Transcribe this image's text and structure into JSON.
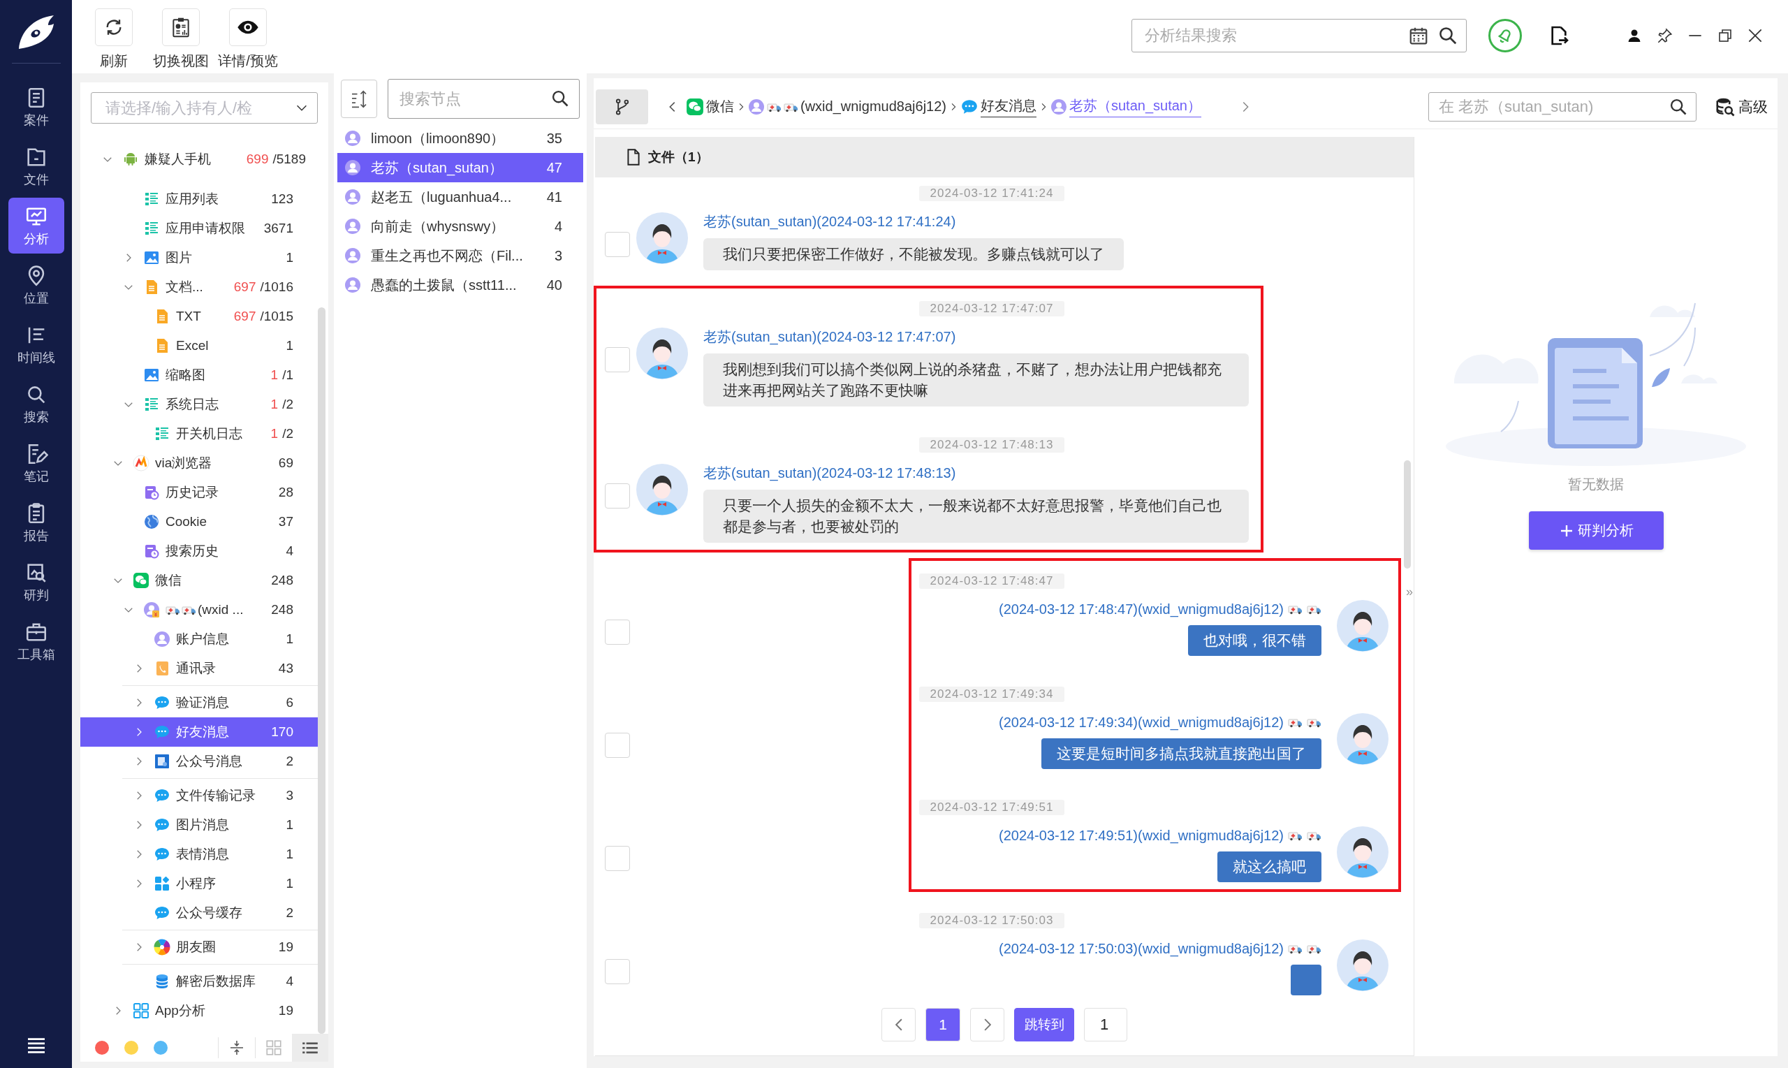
{
  "nav": {
    "items": [
      {
        "kind": "case",
        "label": "案件",
        "selected": false
      },
      {
        "kind": "file",
        "label": "文件",
        "selected": false
      },
      {
        "kind": "analysis",
        "label": "分析",
        "selected": true
      },
      {
        "kind": "location",
        "label": "位置",
        "selected": false
      },
      {
        "kind": "timeline",
        "label": "时间线",
        "selected": false
      },
      {
        "kind": "search",
        "label": "搜索",
        "selected": false
      },
      {
        "kind": "notes",
        "label": "笔记",
        "selected": false
      },
      {
        "kind": "report",
        "label": "报告",
        "selected": false
      },
      {
        "kind": "judge",
        "label": "研判",
        "selected": false
      },
      {
        "kind": "toolbox",
        "label": "工具箱",
        "selected": false
      }
    ]
  },
  "toolbar": {
    "buttons": [
      {
        "kind": "refresh",
        "label": "刷新"
      },
      {
        "kind": "switch-view",
        "label": "切换视图"
      },
      {
        "kind": "preview",
        "label": "详情/预览"
      }
    ]
  },
  "global_search": {
    "placeholder": "分析结果搜索"
  },
  "tree": {
    "holder_select": {
      "placeholder": "请选择/输入持有人/检"
    },
    "items": [
      {
        "kind": "android",
        "label": "嫌疑人手机",
        "hits": "699",
        "total": "/5189",
        "expanded": true,
        "selected": false,
        "children": [
          {
            "children": [
              {
                "kind": "list",
                "label": "应用列表",
                "total": "123",
                "selected": false
              },
              {
                "kind": "list",
                "label": "应用申请权限",
                "total": "3671",
                "selected": false
              },
              {
                "kind": "image",
                "label": "图片",
                "total": "1",
                "expanded": false,
                "selected": false
              },
              {
                "kind": "doc",
                "label": "文档...",
                "hits": "697",
                "total": "/1016",
                "expanded": true,
                "selected": false,
                "children": [
                  {
                    "kind": "doc",
                    "label": "TXT",
                    "hits": "697",
                    "total": "/1015",
                    "selected": false
                  },
                  {
                    "kind": "doc",
                    "label": "Excel",
                    "total": "1",
                    "selected": false
                  }
                ]
              },
              {
                "kind": "image",
                "label": "缩略图",
                "hits": "1",
                "total": "/1",
                "selected": false
              },
              {
                "kind": "list",
                "label": "系统日志",
                "hits": "1",
                "total": "/2",
                "expanded": true,
                "selected": false,
                "children": [
                  {
                    "kind": "list",
                    "label": "开关机日志",
                    "hits": "1",
                    "total": "/2",
                    "selected": false
                  }
                ]
              }
            ]
          },
          {
            "kind": "browser",
            "label": "via浏览器",
            "total": "69",
            "expanded": true,
            "selected": false,
            "children": [
              {
                "kind": "history",
                "label": "历史记录",
                "total": "28",
                "selected": false
              },
              {
                "kind": "globe",
                "label": "Cookie",
                "total": "37",
                "selected": false
              },
              {
                "kind": "history",
                "label": "搜索历史",
                "total": "4",
                "selected": false
              }
            ]
          },
          {
            "kind": "wechat",
            "label": "微信",
            "total": "248",
            "expanded": true,
            "selected": false,
            "children": [
              {
                "kind": "account",
                "label": "(wxid ...",
                "total": "248",
                "expanded": true,
                "selected": false,
                "children": [
                  {
                    "kind": "avatar",
                    "label": "账户信息",
                    "total": "1",
                    "selected": false
                  },
                  {
                    "kind": "contacts",
                    "label": "通讯录",
                    "total": "43",
                    "expanded": false,
                    "selected": false,
                    "divider": true
                  },
                  {
                    "kind": "chat",
                    "label": "验证消息",
                    "total": "6",
                    "expanded": false,
                    "selected": false
                  },
                  {
                    "kind": "chat",
                    "label": "好友消息",
                    "total": "170",
                    "expanded": false,
                    "selected": true
                  },
                  {
                    "kind": "official",
                    "label": "公众号消息",
                    "total": "2",
                    "expanded": false,
                    "selected": false,
                    "divider": true
                  },
                  {
                    "kind": "chat",
                    "label": "文件传输记录",
                    "total": "3",
                    "expanded": false,
                    "selected": false
                  },
                  {
                    "kind": "chat",
                    "label": "图片消息",
                    "total": "1",
                    "expanded": false,
                    "selected": false
                  },
                  {
                    "kind": "chat",
                    "label": "表情消息",
                    "total": "1",
                    "expanded": false,
                    "selected": false
                  },
                  {
                    "kind": "miniapp",
                    "label": "小程序",
                    "total": "1",
                    "expanded": false,
                    "selected": false
                  },
                  {
                    "kind": "chat",
                    "label": "公众号缓存",
                    "total": "2",
                    "selected": false,
                    "divider": true
                  },
                  {
                    "kind": "moments",
                    "label": "朋友圈",
                    "total": "19",
                    "expanded": false,
                    "selected": false,
                    "divider": true
                  },
                  {
                    "kind": "database",
                    "label": "解密后数据库",
                    "total": "4",
                    "selected": false
                  }
                ]
              }
            ]
          },
          {
            "kind": "apps",
            "label": "App分析",
            "total": "19",
            "expanded": false,
            "selected": false
          }
        ]
      }
    ],
    "theme_dots": [
      {
        "color": "#fa5f57"
      },
      {
        "color": "#fdd54f"
      },
      {
        "color": "#57b9f5"
      }
    ],
    "view_buttons": [
      {
        "kind": "grid",
        "selected": false
      },
      {
        "kind": "list",
        "selected": true
      }
    ]
  },
  "contacts": {
    "search": {
      "placeholder": "搜索节点"
    },
    "items": [
      {
        "name": "limoon（limoon890）",
        "count": "35",
        "selected": false
      },
      {
        "name": "老苏（sutan_sutan）",
        "count": "47",
        "selected": true
      },
      {
        "name": "赵老五（luguanhua4...",
        "count": "41",
        "selected": false
      },
      {
        "name": "向前走（whysnswy）",
        "count": "4",
        "selected": false
      },
      {
        "name": "重生之再也不网恋（Fil...",
        "count": "3",
        "selected": false
      },
      {
        "name": "愚蠢的土拨鼠（sstt11...",
        "count": "40",
        "selected": false
      }
    ]
  },
  "breadcrumb": {
    "items": [
      {
        "kind": "wechat",
        "label": "微信",
        "selected": false
      },
      {
        "kind": "account",
        "label": "(wxid_wnigmud8aj6j12)",
        "selected": false
      },
      {
        "kind": "chat",
        "label": "好友消息",
        "selected": false
      },
      {
        "kind": "contact",
        "label": "老苏（sutan_sutan）",
        "selected": true
      }
    ]
  },
  "chat_search": {
    "placeholder": "在 老苏（sutan_sutan)"
  },
  "advanced_button": "高级",
  "file_tab": "文件（1）",
  "messages": [
    {
      "kind": "incoming",
      "time": "2024-03-12 17:41:24",
      "sender": "老苏(sutan_sutan)(2024-03-12 17:41:24)",
      "text": "我们只要把保密工作做好，不能被发现。多赚点钱就可以了",
      "checked": false,
      "marked": false
    },
    {
      "kind": "incoming",
      "time": "2024-03-12 17:47:07",
      "sender": "老苏(sutan_sutan)(2024-03-12 17:47:07)",
      "text": "我刚想到我们可以搞个类似网上说的杀猪盘，不赌了，想办法让用户把钱都充进来再把网站关了跑路不更快嘛",
      "checked": false,
      "marked": true
    },
    {
      "kind": "incoming",
      "time": "2024-03-12 17:48:13",
      "sender": "老苏(sutan_sutan)(2024-03-12 17:48:13)",
      "text": "只要一个人损失的金额不太大，一般来说都不太好意思报警，毕竟他们自己也都是参与者，也要被处罚的",
      "checked": false,
      "marked": true
    },
    {
      "kind": "outgoing",
      "time": "2024-03-12 17:48:47",
      "sender": "(2024-03-12 17:48:47)(wxid_wnigmud8aj6j12)",
      "text": "也对哦，很不错",
      "checked": false,
      "marked": true
    },
    {
      "kind": "outgoing",
      "time": "2024-03-12 17:49:34",
      "sender": "(2024-03-12 17:49:34)(wxid_wnigmud8aj6j12)",
      "text": "这要是短时间多搞点我就直接跑出国了",
      "checked": false,
      "marked": true
    },
    {
      "kind": "outgoing",
      "time": "2024-03-12 17:49:51",
      "sender": "(2024-03-12 17:49:51)(wxid_wnigmud8aj6j12)",
      "text": "就这么搞吧",
      "checked": false,
      "marked": true
    },
    {
      "kind": "outgoing",
      "time": "2024-03-12 17:50:03",
      "sender": "(2024-03-12 17:50:03)(wxid_wnigmud8aj6j12)",
      "checked": false,
      "marked": false
    }
  ],
  "collapse_handle": "»",
  "pagination": {
    "pages": [
      {
        "label": "1",
        "selected": true
      }
    ],
    "jump_label": "跳转到",
    "jump_value": "1"
  },
  "detail": {
    "empty_text": "暂无数据",
    "action_label": "研判分析"
  }
}
